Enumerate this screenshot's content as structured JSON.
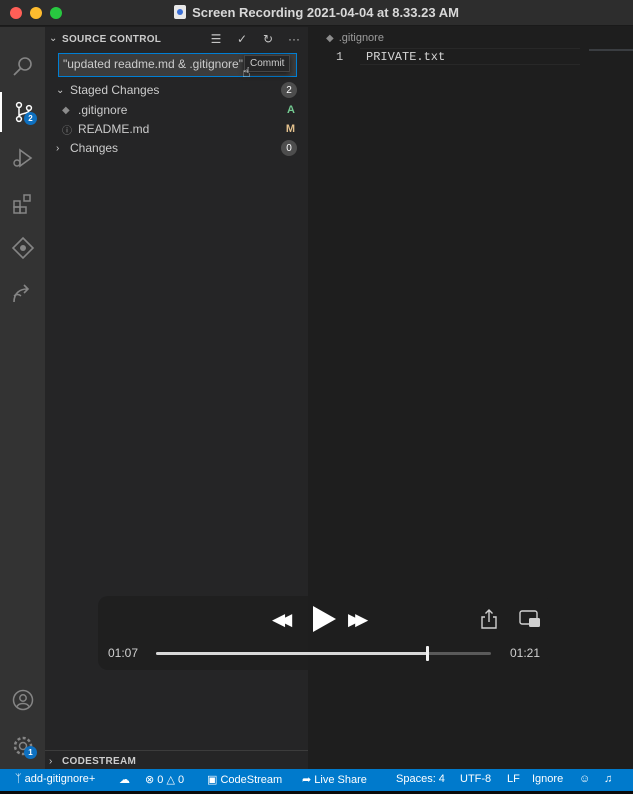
{
  "window": {
    "title": "Screen Recording 2021-04-04 at 8.33.23 AM"
  },
  "activity_bar": {
    "scm_badge": "2",
    "settings_badge": "1"
  },
  "sidebar": {
    "title": "SOURCE CONTROL",
    "commit_message": "\"updated readme.md & .gitignore\"",
    "tooltip": "Commit",
    "staged": {
      "label": "Staged Changes",
      "count": "2"
    },
    "files": [
      {
        "name": ".gitignore",
        "status": "A",
        "status_color": "#73c991"
      },
      {
        "name": "README.md",
        "status": "M",
        "status_color": "#e2c08d"
      }
    ],
    "changes": {
      "label": "Changes",
      "count": "0"
    },
    "bottom_section": "CODESTREAM"
  },
  "editor": {
    "tab": ".gitignore",
    "line_number": "1",
    "line_content": "PRIVATE.txt"
  },
  "player": {
    "elapsed": "01:07",
    "total": "01:21",
    "progress": 0.81
  },
  "statusbar": {
    "branch": "add-gitignore+",
    "errors": "0",
    "warnings": "0",
    "codestream": "CodeStream",
    "live_share": "Live Share",
    "spaces": "Spaces: 4",
    "encoding": "UTF-8",
    "eol": "LF",
    "ignore": "Ignore"
  },
  "colors": {
    "accent": "#007acc",
    "focus_border": "#007fd4",
    "badge": "#0e70c0"
  }
}
